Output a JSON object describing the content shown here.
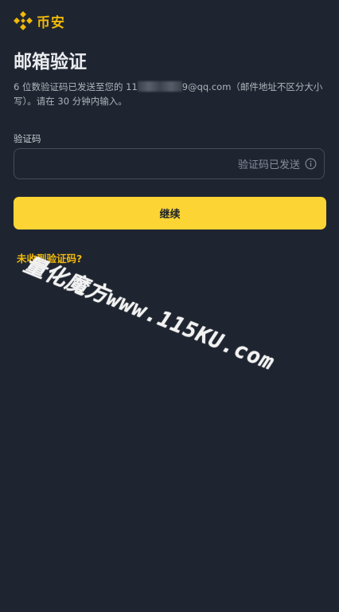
{
  "brand": {
    "name": "币安",
    "accent_color": "#f0b90b"
  },
  "page": {
    "title": "邮箱验证",
    "description_prefix": "6 位数验证码已发送至您的 11",
    "description_suffix": "9@qq.com（邮件地址不区分大小写）。请在 30 分钟内输入。"
  },
  "code_field": {
    "label": "验证码",
    "value": "",
    "sent_status": "验证码已发送",
    "info_icon": "info-circle-icon"
  },
  "continue_button": {
    "label": "继续",
    "color": "#fcd535"
  },
  "help_link": {
    "label": "未收到验证码?"
  },
  "watermark": {
    "text": "量化魔方www.115KU.com"
  }
}
